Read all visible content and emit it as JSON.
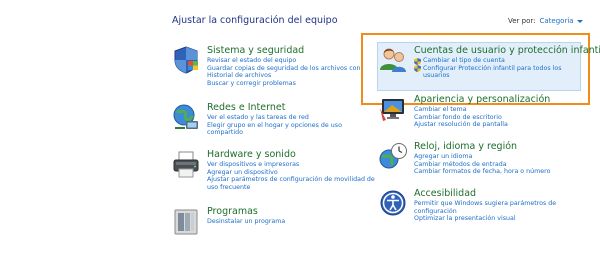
{
  "header": {
    "title": "Ajustar la configuración del equipo",
    "view_by_label": "Ver por:",
    "view_by_value": "Categoría"
  },
  "left": [
    {
      "title": "Sistema y seguridad",
      "icon": "shield-flag-icon",
      "links": [
        "Revisar el estado del equipo",
        "Guardar copias de seguridad de los archivos con Historial de archivos",
        "Buscar y corregir problemas"
      ]
    },
    {
      "title": "Redes e Internet",
      "icon": "network-globe-icon",
      "links": [
        "Ver el estado y las tareas de red",
        "Elegir grupo en el hogar y opciones de uso compartido"
      ]
    },
    {
      "title": "Hardware y sonido",
      "icon": "printer-icon",
      "links": [
        "Ver dispositivos e impresoras",
        "Agregar un dispositivo",
        "Ajustar parámetros de configuración de movilidad de uso frecuente"
      ]
    },
    {
      "title": "Programas",
      "icon": "programs-icon",
      "links": [
        "Desinstalar un programa"
      ]
    }
  ],
  "right": [
    {
      "title": "Cuentas de usuario y protección infantil",
      "icon": "users-icon",
      "links": [
        "Cambiar el tipo de cuenta",
        "Configurar Protección infantil para todos los usuarios"
      ]
    },
    {
      "title": "Apariencia y personalización",
      "icon": "monitor-paint-icon",
      "links": [
        "Cambiar el tema",
        "Cambiar fondo de escritorio",
        "Ajustar resolución de pantalla"
      ]
    },
    {
      "title": "Reloj, idioma y región",
      "icon": "clock-globe-icon",
      "links": [
        "Agregar un idioma",
        "Cambiar métodos de entrada",
        "Cambiar formatos de fecha, hora o número"
      ]
    },
    {
      "title": "Accesibilidad",
      "icon": "accessibility-icon",
      "links": [
        "Permitir que Windows sugiera parámetros de configuración",
        "Optimizar la presentación visual"
      ]
    }
  ],
  "colors": {
    "title": "#1e3287",
    "category": "#1e6e2d",
    "link": "#1e6ec8",
    "highlight_bg": "#e2effb",
    "focus_frame": "#f08c1c"
  }
}
